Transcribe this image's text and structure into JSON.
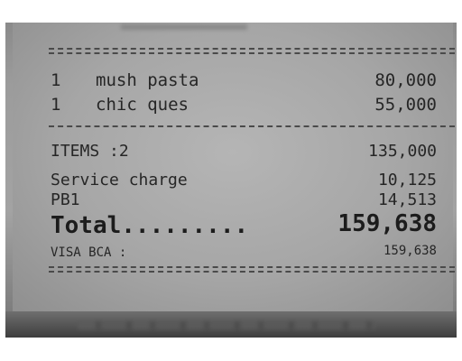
{
  "items": [
    {
      "qty": "1",
      "name": "mush pasta",
      "price": "80,000"
    },
    {
      "qty": "1",
      "name": "chic ques",
      "price": "55,000"
    }
  ],
  "summary": {
    "items_label": "ITEMS :2",
    "items_value": "135,000",
    "service_label": "Service charge",
    "service_value": "10,125",
    "pb1_label": "PB1",
    "pb1_value": "14,513",
    "total_label": "Total.........",
    "total_value": "159,638",
    "payment_label": "VISA BCA :",
    "payment_value": "159,638"
  }
}
